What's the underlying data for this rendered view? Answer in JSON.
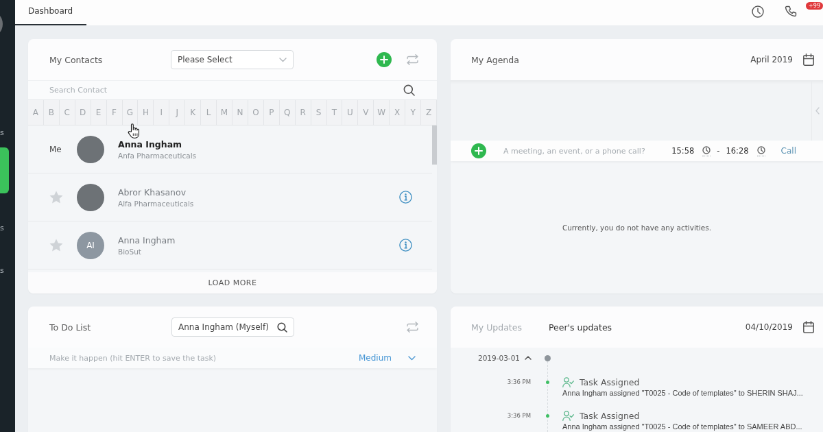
{
  "sidebar": {
    "items": [
      {
        "label": "s",
        "selected": false
      },
      {
        "selected": true
      },
      {
        "label": "s",
        "selected": false
      },
      {
        "label": "s",
        "selected": false
      }
    ]
  },
  "header": {
    "tabs": [
      {
        "label": "Dashboard",
        "selected": true
      }
    ],
    "notification_count": "+99"
  },
  "contacts": {
    "title": "My Contacts",
    "filter": {
      "value": "Please Select"
    },
    "search": {
      "placeholder": "Search Contact"
    },
    "letters": [
      "A",
      "B",
      "C",
      "D",
      "E",
      "F",
      "G",
      "H",
      "I",
      "J",
      "K",
      "L",
      "M",
      "N",
      "O",
      "P",
      "Q",
      "R",
      "S",
      "T",
      "U",
      "V",
      "W",
      "X",
      "Y",
      "Z"
    ],
    "rows": [
      {
        "kind": "me",
        "label": "Me",
        "avatar": {
          "kind": "photo"
        },
        "name": "Anna Ingham",
        "company": "Anfa Pharmaceuticals"
      },
      {
        "kind": "contact",
        "starred": false,
        "avatar": {
          "kind": "photo"
        },
        "name": "Abror Khasanov",
        "company": "Alfa Pharmaceuticals"
      },
      {
        "kind": "contact",
        "starred": false,
        "avatar": {
          "kind": "initials",
          "initials": "AI"
        },
        "name": "Anna Ingham",
        "company": "BioSut"
      }
    ],
    "load_more": "LOAD MORE"
  },
  "agenda": {
    "title": "My Agenda",
    "month": "April 2019",
    "new_entry": {
      "placeholder": "A meeting, an event, or a phone call?",
      "start": "15:58",
      "separator": "-",
      "end": "16:28",
      "type": "Call"
    },
    "empty_message": "Currently, you do not have any activities."
  },
  "todo": {
    "title": "To Do List",
    "assignee": {
      "value": "Anna Ingham (Myself)"
    },
    "new_task": {
      "placeholder": "Make it happen (hit ENTER to save the task)",
      "priority": "Medium"
    }
  },
  "updates": {
    "tabs": [
      {
        "label": "My Updates",
        "selected": false
      },
      {
        "label": "Peer's updates",
        "selected": true
      }
    ],
    "date": "04/10/2019",
    "groups": [
      {
        "date": "2019-03-01",
        "expanded": true,
        "entries": [
          {
            "time": "3:36 PM",
            "title": "Task Assigned",
            "text": "Anna Ingham assigned \"T0025 - Code of templates\" to SHERIN SHAJ..."
          },
          {
            "time": "3:36 PM",
            "title": "Task Assigned",
            "text": "Anna Ingham assigned \"T0025 - Code of templates\" to SAMEER ABD..."
          }
        ]
      }
    ]
  }
}
